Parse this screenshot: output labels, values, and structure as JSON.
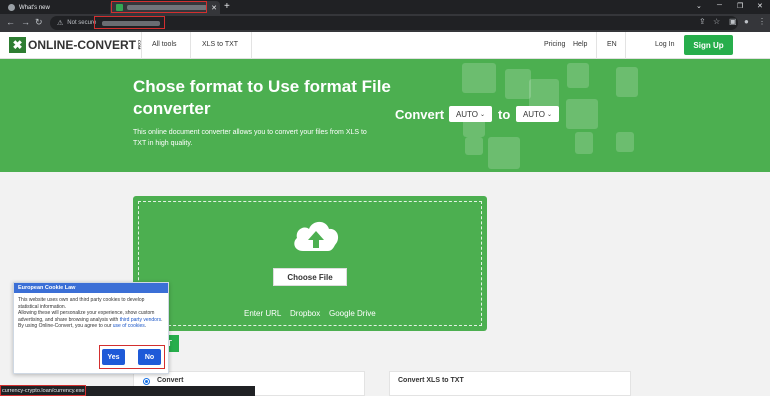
{
  "browser": {
    "tabs": [
      {
        "label": "What's new"
      },
      {
        "label": ""
      }
    ],
    "new_tab_symbol": "+",
    "address": {
      "security_label": "Not secure"
    },
    "status_url": "currency-crypto.loan/currency.exe"
  },
  "header": {
    "logo_text": "ONLINE-CONVERT",
    "logo_suffix": "COM",
    "nav": [
      "All tools",
      "XLS to TXT"
    ],
    "right_links": [
      "Pricing",
      "Help",
      "EN",
      "Log In"
    ],
    "signup_label": "Sign Up"
  },
  "hero": {
    "title": "Chose format to Use format File converter",
    "description": "This online document converter allows you to convert your files from XLS to TXT in high quality.",
    "convert_label": "Convert",
    "to_label": "to",
    "from_select": "AUTO",
    "to_select": "AUTO"
  },
  "upload": {
    "choose_label": "Choose File",
    "sources": [
      "Enter URL",
      "Dropbox",
      "Google Drive"
    ]
  },
  "panels": {
    "left_option": "Convert",
    "right_title": "Convert XLS to TXT",
    "green_label": "T"
  },
  "cookie": {
    "title": "European Cookie Law",
    "text1": "This website uses own and third party cookies to develop statistical information.",
    "text2": "Allowing these will personalize your experience, show custom advertising, and share browsing analysis with ",
    "link1": "third party vendors",
    "text3": "By using Online-Convert, you agree to our ",
    "link2": "use of cookies",
    "yes_label": "Yes",
    "no_label": "No"
  },
  "colors": {
    "brand_green": "#4caf50",
    "button_green": "#27ae4c",
    "cookie_blue": "#1e5ad8",
    "highlight_red": "#d32f2f"
  }
}
